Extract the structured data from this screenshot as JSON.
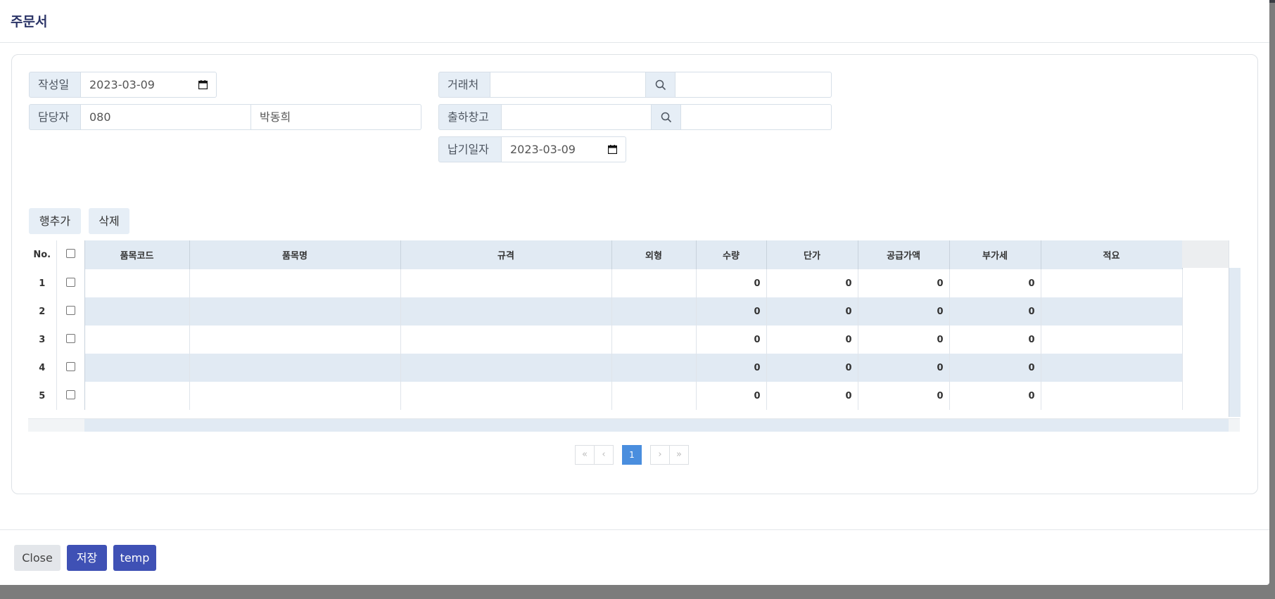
{
  "modal": {
    "title": "주문서"
  },
  "form": {
    "written_date": {
      "label": "작성일",
      "value": "2023-03-09"
    },
    "manager": {
      "label": "담당자",
      "code": "080",
      "name": "박동희"
    },
    "client": {
      "label": "거래처",
      "code": "",
      "name": ""
    },
    "warehouse": {
      "label": "출하창고",
      "code": "",
      "name": ""
    },
    "delivery_date": {
      "label": "납기일자",
      "value": "2023-03-09"
    }
  },
  "toolbar": {
    "add_row": "행추가",
    "delete": "삭제"
  },
  "grid": {
    "columns": [
      "No.",
      "",
      "품목코드",
      "품목명",
      "규격",
      "외형",
      "수량",
      "단가",
      "공급가액",
      "부가세",
      "적요"
    ],
    "rows": [
      {
        "no": "1",
        "qty": "0",
        "price": "0",
        "supply": "0",
        "vat": "0"
      },
      {
        "no": "2",
        "qty": "0",
        "price": "0",
        "supply": "0",
        "vat": "0"
      },
      {
        "no": "3",
        "qty": "0",
        "price": "0",
        "supply": "0",
        "vat": "0"
      },
      {
        "no": "4",
        "qty": "0",
        "price": "0",
        "supply": "0",
        "vat": "0"
      },
      {
        "no": "5",
        "qty": "0",
        "price": "0",
        "supply": "0",
        "vat": "0"
      }
    ]
  },
  "pagination": {
    "first": "«",
    "prev": "‹",
    "current": "1",
    "next": "›",
    "last": "»"
  },
  "footer": {
    "close": "Close",
    "save": "저장",
    "temp": "temp"
  },
  "colors": {
    "primary": "#3f51b5",
    "label_bg": "#e6eef6",
    "active_page": "#4a8ede"
  }
}
